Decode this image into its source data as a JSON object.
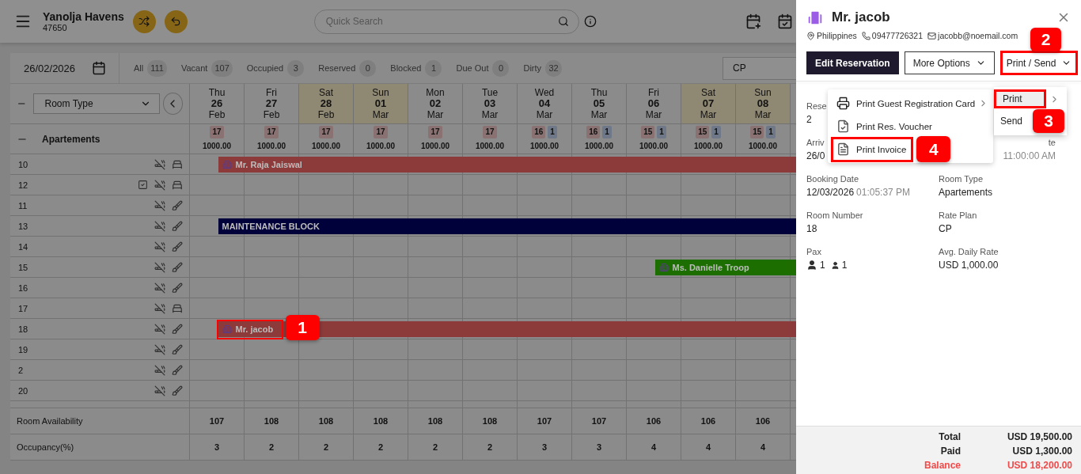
{
  "header": {
    "hotel_name": "Yanolja Havens",
    "hotel_code": "47650",
    "search": {
      "placeholder": "Quick Search"
    }
  },
  "toolbar": {
    "date": "26/02/2026",
    "filters": [
      {
        "label": "All",
        "count": "111"
      },
      {
        "label": "Vacant",
        "count": "107"
      },
      {
        "label": "Occupied",
        "count": "3"
      },
      {
        "label": "Reserved",
        "count": "0"
      },
      {
        "label": "Blocked",
        "count": "1"
      },
      {
        "label": "Due Out",
        "count": "0"
      },
      {
        "label": "Dirty",
        "count": "32"
      }
    ],
    "rate_plan": "CP"
  },
  "grid": {
    "group_by": "Room Type",
    "group": "Apartements",
    "days": [
      {
        "weekday": "Thu",
        "day": "26",
        "month": "Feb",
        "weekend": false,
        "available": "17",
        "rate": "1000.00"
      },
      {
        "weekday": "Fri",
        "day": "27",
        "month": "Feb",
        "weekend": false,
        "available": "17",
        "rate": "1000.00"
      },
      {
        "weekday": "Sat",
        "day": "28",
        "month": "Feb",
        "weekend": true,
        "available": "17",
        "rate": "1000.00"
      },
      {
        "weekday": "Sun",
        "day": "01",
        "month": "Mar",
        "weekend": true,
        "available": "17",
        "rate": "1000.00"
      },
      {
        "weekday": "Mon",
        "day": "02",
        "month": "Mar",
        "weekend": false,
        "available": "17",
        "rate": "1000.00"
      },
      {
        "weekday": "Tue",
        "day": "03",
        "month": "Mar",
        "weekend": false,
        "available": "17",
        "rate": "1000.00"
      },
      {
        "weekday": "Wed",
        "day": "04",
        "month": "Mar",
        "weekend": false,
        "available": "16",
        "blocked": "1",
        "rate": "1000.00"
      },
      {
        "weekday": "Thu",
        "day": "05",
        "month": "Mar",
        "weekend": false,
        "available": "16",
        "blocked": "1",
        "rate": "1000.00"
      },
      {
        "weekday": "Fri",
        "day": "06",
        "month": "Mar",
        "weekend": false,
        "available": "15",
        "blocked": "1",
        "rate": "1000.00"
      },
      {
        "weekday": "Sat",
        "day": "07",
        "month": "Mar",
        "weekend": true,
        "available": "15",
        "blocked": "1",
        "rate": "1000.00"
      },
      {
        "weekday": "Sun",
        "day": "08",
        "month": "Mar",
        "weekend": true,
        "available": "15",
        "blocked": "1",
        "rate": "1000.00"
      }
    ],
    "rooms": [
      {
        "number": "10",
        "inspected": false,
        "dirty": false,
        "booking": {
          "kind": "reservation",
          "guest": "Mr. Raja Jaiswal",
          "color": "#8c3a3a",
          "highlighted": false
        }
      },
      {
        "number": "12",
        "inspected": true,
        "dirty": false
      },
      {
        "number": "11",
        "inspected": false,
        "dirty": true
      },
      {
        "number": "13",
        "inspected": false,
        "dirty": true,
        "booking": {
          "kind": "block",
          "guest": "MAINTENANCE BLOCK",
          "color": "#00003a",
          "highlighted": false
        }
      },
      {
        "number": "14",
        "inspected": false,
        "dirty": true
      },
      {
        "number": "15",
        "inspected": false,
        "dirty": true,
        "booking": {
          "kind": "reservation",
          "guest": "Ms. Danielle Troop",
          "color": "#1c6e00",
          "highlighted": false
        }
      },
      {
        "number": "16",
        "inspected": false,
        "dirty": true
      },
      {
        "number": "17",
        "inspected": false,
        "dirty": false
      },
      {
        "number": "18",
        "inspected": false,
        "dirty": true,
        "booking": {
          "kind": "reservation",
          "guest": "Mr. jacob",
          "color": "#8c3a3a",
          "highlighted": true,
          "annotation": "1"
        }
      },
      {
        "number": "19",
        "inspected": false,
        "dirty": true
      },
      {
        "number": "2",
        "inspected": false,
        "dirty": true
      },
      {
        "number": "20",
        "inspected": false,
        "dirty": true
      }
    ],
    "summary": [
      {
        "label": "Room Availability",
        "values": [
          "107",
          "108",
          "108",
          "108",
          "108",
          "108",
          "107",
          "107",
          "106",
          "106",
          "106"
        ]
      },
      {
        "label": "Occupancy(%)",
        "values": [
          "3",
          "2",
          "2",
          "2",
          "2",
          "2",
          "3",
          "3",
          "4",
          "4",
          "4"
        ]
      }
    ]
  },
  "drawer": {
    "guest": "Mr. jacob",
    "country": "Philippines",
    "phone": "09477726321",
    "email": "jacobb@noemail.com",
    "buttons": [
      {
        "label": "Edit Reservation",
        "kind": "primary",
        "highlighted": false
      },
      {
        "label": "More Options",
        "kind": "dropdown",
        "highlighted": false
      },
      {
        "label": "Print / Send",
        "kind": "dropdown",
        "highlighted": true,
        "annotation": "2"
      }
    ],
    "field_rows": [
      {
        "left": {
          "label": "Rese",
          "value": "2"
        }
      },
      {
        "left": {
          "label": "Arriv",
          "value": "26/0"
        },
        "right": {
          "label": "te",
          "time": "11:00:00 AM",
          "covered": true
        }
      },
      {
        "left": {
          "label": "Booking Date",
          "value": "12/03/2026",
          "time": "01:05:37 PM"
        },
        "right": {
          "label": "Room Type",
          "value": "Apartements"
        }
      },
      {
        "left": {
          "label": "Room Number",
          "value": "18"
        },
        "right": {
          "label": "Rate Plan",
          "value": "CP"
        }
      },
      {
        "left": {
          "label": "Pax",
          "kind": "pax",
          "adults": "1",
          "children": "1"
        },
        "right": {
          "label": "Avg. Daily Rate",
          "value": "USD 1,000.00"
        }
      }
    ],
    "print_menu": [
      {
        "label": "Print Guest Registration Card",
        "submenu": true,
        "highlighted": false
      },
      {
        "label": "Print Res. Voucher",
        "submenu": false,
        "highlighted": false
      },
      {
        "label": "Print Invoice",
        "submenu": false,
        "highlighted": true,
        "annotation": "4"
      }
    ],
    "send_menu": {
      "annotation": "3",
      "items": [
        {
          "label": "Print",
          "submenu": true,
          "highlighted": true
        },
        {
          "label": "Send",
          "submenu": false,
          "highlighted": false
        }
      ]
    },
    "totals": [
      {
        "label": "Total",
        "value": "USD 19,500.00",
        "negative": false
      },
      {
        "label": "Paid",
        "value": "USD 1,300.00",
        "negative": false
      },
      {
        "label": "Balance",
        "value": "USD 18,200.00",
        "negative": true
      }
    ]
  }
}
